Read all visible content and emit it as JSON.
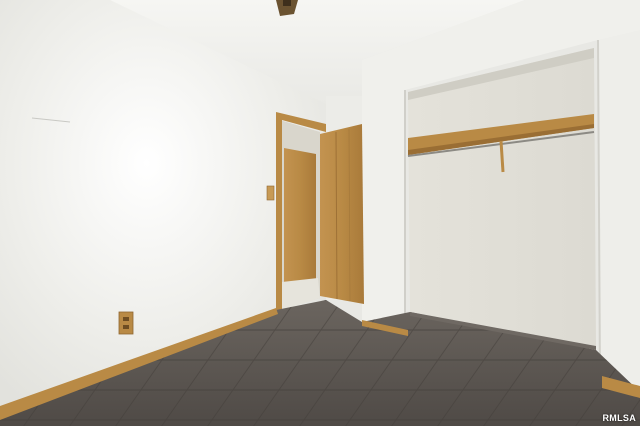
{
  "photo": {
    "watermark": "RMLSA",
    "colors": {
      "wall": "#ecece8",
      "ceiling": "#f2f2ef",
      "wood": "#b98a45",
      "floor": "#5a5551"
    },
    "objects": [
      "ceiling-fan",
      "open-doorway",
      "wooden-closet-door",
      "open-closet",
      "closet-shelf",
      "clothes-rod",
      "power-outlet",
      "light-switch",
      "baseboard",
      "tile-floor"
    ]
  }
}
